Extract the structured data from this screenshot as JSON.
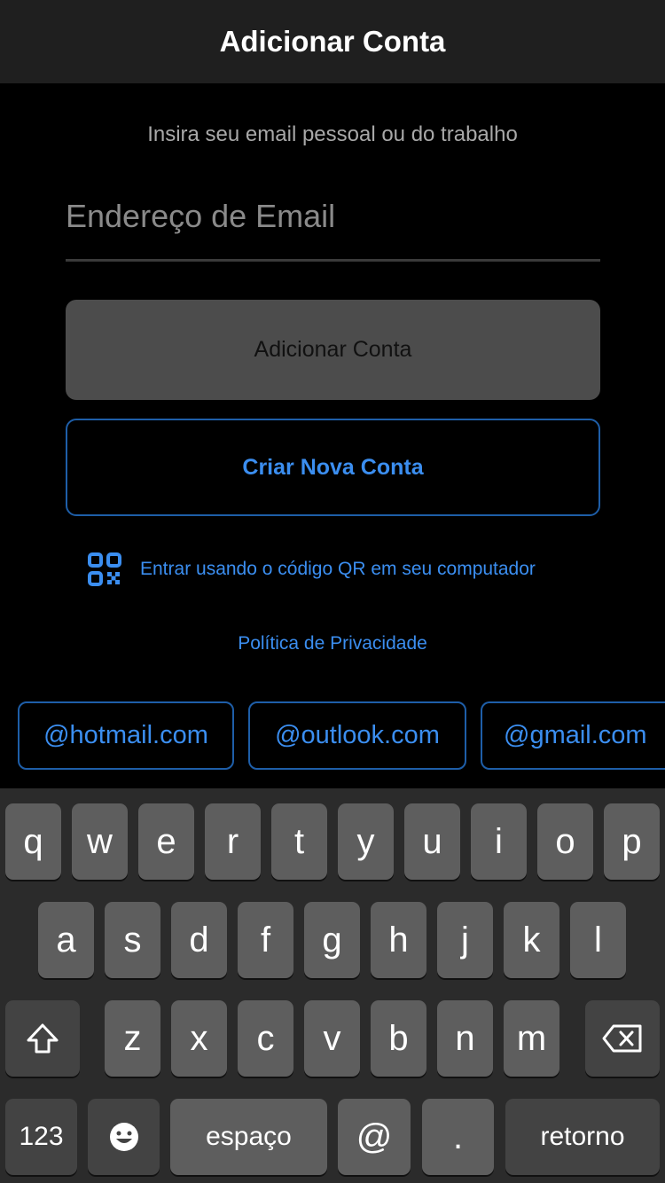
{
  "header": {
    "title": "Adicionar Conta"
  },
  "form": {
    "subtitle": "Insira seu email pessoal ou do trabalho",
    "email_placeholder": "Endereço de Email",
    "email_value": "",
    "add_button": "Adicionar Conta",
    "create_button": "Criar Nova Conta",
    "qr_link": "Entrar usando o código QR em seu computador",
    "privacy_link": "Política de Privacidade",
    "accent_color": "#3b8ef0"
  },
  "domain_suggestions": [
    "@hotmail.com",
    "@outlook.com",
    "@gmail.com"
  ],
  "keyboard": {
    "row1": [
      "q",
      "w",
      "e",
      "r",
      "t",
      "y",
      "u",
      "i",
      "o",
      "p"
    ],
    "row2": [
      "a",
      "s",
      "d",
      "f",
      "g",
      "h",
      "j",
      "k",
      "l"
    ],
    "row3": [
      "z",
      "x",
      "c",
      "v",
      "b",
      "n",
      "m"
    ],
    "shift_icon": "shift-icon",
    "backspace_icon": "backspace-icon",
    "emoji_icon": "emoji-icon",
    "numbers_label": "123",
    "space_label": "espaço",
    "at_label": "@",
    "dot_label": ".",
    "return_label": "retorno"
  }
}
